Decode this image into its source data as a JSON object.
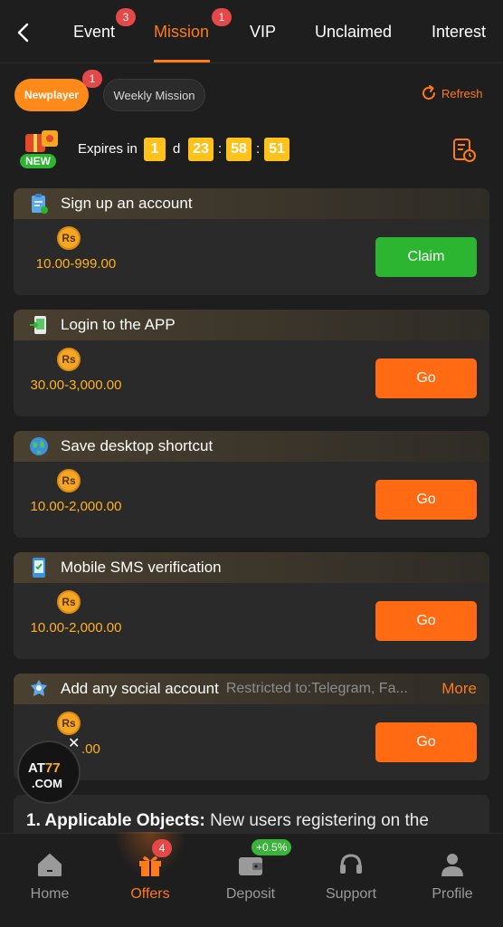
{
  "topnav": {
    "tabs": [
      {
        "label": "Event",
        "badge": "3"
      },
      {
        "label": "Mission",
        "badge": "1",
        "active": true
      },
      {
        "label": "VIP"
      },
      {
        "label": "Unclaimed"
      },
      {
        "label": "Interest"
      }
    ]
  },
  "filters": {
    "newplayer": "Newplayer",
    "newplayer_badge": "1",
    "weekly": "Weekly Mission",
    "refresh": "Refresh"
  },
  "expires": {
    "label": "Expires in",
    "days": "1",
    "day_unit": "d",
    "hours": "23",
    "minutes": "58",
    "seconds": "51",
    "sep": ":",
    "gift_text": "NEW"
  },
  "tasks": [
    {
      "title": "Sign up an account",
      "currency": "Rs",
      "amount": "10.00-999.00",
      "button": "Claim",
      "button_type": "claim",
      "icon": "clipboard-icon"
    },
    {
      "title": "Login to the APP",
      "currency": "Rs",
      "amount": "30.00-3,000.00",
      "button": "Go",
      "button_type": "go",
      "icon": "phone-login-icon"
    },
    {
      "title": "Save desktop shortcut",
      "currency": "Rs",
      "amount": "10.00-2,000.00",
      "button": "Go",
      "button_type": "go",
      "icon": "globe-icon"
    },
    {
      "title": "Mobile SMS verification",
      "currency": "Rs",
      "amount": "10.00-2,000.00",
      "button": "Go",
      "button_type": "go",
      "icon": "mobile-sms-icon"
    },
    {
      "title": "Add any social account",
      "restriction": "Restricted to:Telegram, Fa...",
      "more": "More",
      "currency": "Rs",
      "amount": ".00",
      "button": "Go",
      "button_type": "go",
      "icon": "social-bird-icon"
    }
  ],
  "rules": {
    "heading": "1. Applicable Objects:",
    "text": " New users registering on the"
  },
  "floating_logo": {
    "brand_a": "AT",
    "brand_b": "77",
    "domain": ".COM",
    "close": "✕"
  },
  "bottomnav": {
    "items": [
      {
        "label": "Home",
        "icon": "home-icon"
      },
      {
        "label": "Offers",
        "icon": "gift-icon",
        "badge": "4",
        "active": true
      },
      {
        "label": "Deposit",
        "icon": "wallet-icon",
        "badge": "+0.5%"
      },
      {
        "label": "Support",
        "icon": "headset-icon"
      },
      {
        "label": "Profile",
        "icon": "profile-icon"
      }
    ]
  },
  "colors": {
    "accent": "#ff7a1a",
    "claim": "#2cb531",
    "go": "#ff6a12",
    "amount": "#ffb020",
    "timer": "#ffc21a",
    "badge": "#e54848"
  }
}
